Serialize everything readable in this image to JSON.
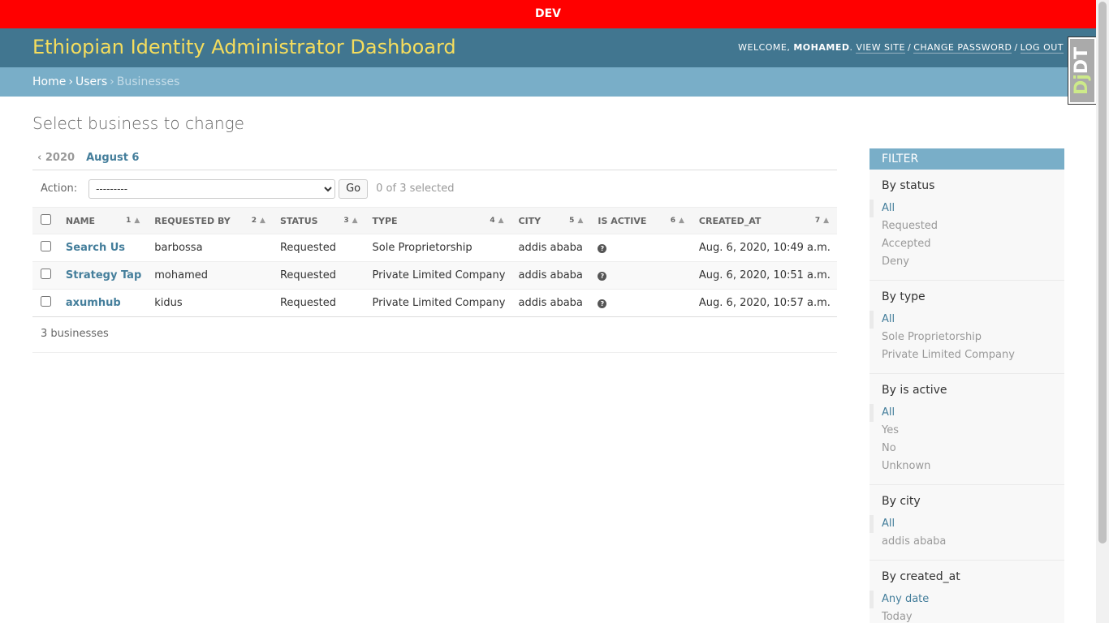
{
  "env_banner": "DEV",
  "header": {
    "brand": "Ethiopian Identity Administrator Dashboard",
    "welcome": "WELCOME,",
    "username": "MOHAMED",
    "view_site": "VIEW SITE",
    "change_password": "CHANGE PASSWORD",
    "log_out": "LOG OUT"
  },
  "breadcrumbs": {
    "home": "Home",
    "users": "Users",
    "current": "Businesses"
  },
  "djdt": {
    "label_a": "Dj",
    "label_b": "DT"
  },
  "page": {
    "title": "Select business to change"
  },
  "date_hierarchy": {
    "back": "‹ 2020",
    "current": "August 6"
  },
  "actions": {
    "label": "Action:",
    "selected_option": "---------",
    "go": "Go",
    "counter": "0 of 3 selected"
  },
  "table": {
    "columns": [
      {
        "label": "NAME",
        "order": "1"
      },
      {
        "label": "REQUESTED BY",
        "order": "2"
      },
      {
        "label": "STATUS",
        "order": "3"
      },
      {
        "label": "TYPE",
        "order": "4"
      },
      {
        "label": "CITY",
        "order": "5"
      },
      {
        "label": "IS ACTIVE",
        "order": "6"
      },
      {
        "label": "CREATED_AT",
        "order": "7"
      }
    ],
    "rows": [
      {
        "name": "Search Us",
        "requested_by": "barbossa",
        "status": "Requested",
        "type": "Sole Proprietorship",
        "city": "addis ababa",
        "is_active": "?",
        "created_at": "Aug. 6, 2020, 10:49 a.m."
      },
      {
        "name": "Strategy Tap",
        "requested_by": "mohamed",
        "status": "Requested",
        "type": "Private Limited Company",
        "city": "addis ababa",
        "is_active": "?",
        "created_at": "Aug. 6, 2020, 10:51 a.m."
      },
      {
        "name": "axumhub",
        "requested_by": "kidus",
        "status": "Requested",
        "type": "Private Limited Company",
        "city": "addis ababa",
        "is_active": "?",
        "created_at": "Aug. 6, 2020, 10:57 a.m."
      }
    ]
  },
  "paginator": "3 businesses",
  "filter": {
    "title": "Filter",
    "groups": [
      {
        "title": "By status",
        "options": [
          "All",
          "Requested",
          "Accepted",
          "Deny"
        ]
      },
      {
        "title": "By type",
        "options": [
          "All",
          "Sole Proprietorship",
          "Private Limited Company"
        ]
      },
      {
        "title": "By is active",
        "options": [
          "All",
          "Yes",
          "No",
          "Unknown"
        ]
      },
      {
        "title": "By city",
        "options": [
          "All",
          "addis ababa"
        ]
      },
      {
        "title": "By created_at",
        "options": [
          "Any date",
          "Today"
        ]
      }
    ]
  }
}
